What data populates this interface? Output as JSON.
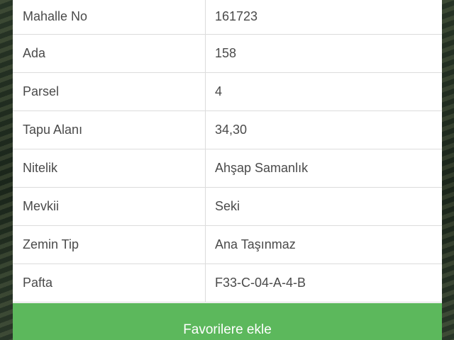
{
  "parcel_details": {
    "rows": [
      {
        "label": "Mahalle No",
        "value": "161723"
      },
      {
        "label": "Ada",
        "value": "158"
      },
      {
        "label": "Parsel",
        "value": "4"
      },
      {
        "label": "Tapu Alanı",
        "value": "34,30"
      },
      {
        "label": "Nitelik",
        "value": "Ahşap Samanlık"
      },
      {
        "label": "Mevkii",
        "value": "Seki"
      },
      {
        "label": "Zemin Tip",
        "value": "Ana Taşınmaz"
      },
      {
        "label": "Pafta",
        "value": "F33-C-04-A-4-B"
      }
    ]
  },
  "actions": {
    "favorite_label": "Favorilere ekle"
  },
  "colors": {
    "button_green": "#5cb85c",
    "panel_background": "#ffffff",
    "text": "#4a4a4a"
  }
}
